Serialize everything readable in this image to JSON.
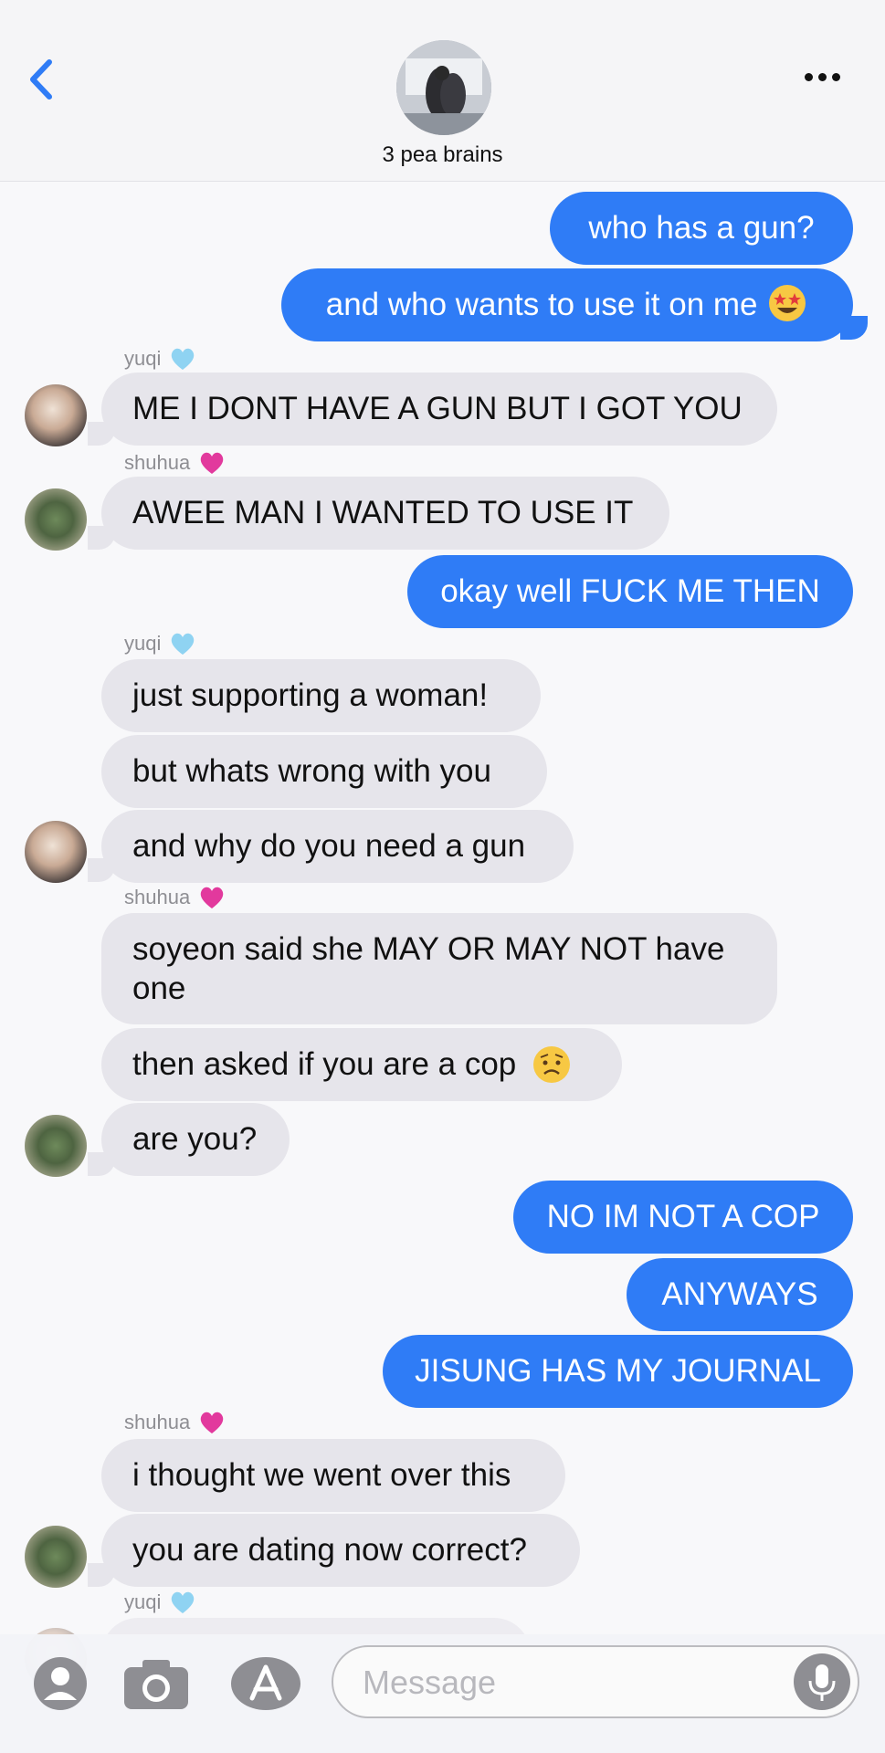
{
  "header": {
    "group_name": "3 pea brains"
  },
  "messages": [
    {
      "side": "out",
      "text": "who has a gun?"
    },
    {
      "side": "out",
      "text": "and who wants to use it on me",
      "emoji": "star-struck-emoji"
    },
    {
      "side": "sender",
      "name": "yuqi",
      "heart": "light-blue-heart"
    },
    {
      "side": "in",
      "text": "ME I DONT HAVE A GUN BUT I GOT YOU"
    },
    {
      "side": "sender",
      "name": "shuhua",
      "heart": "pink-heart"
    },
    {
      "side": "in",
      "text": "AWEE MAN I WANTED TO USE IT"
    },
    {
      "side": "out",
      "text": "okay well FUCK ME THEN"
    },
    {
      "side": "sender",
      "name": "yuqi",
      "heart": "light-blue-heart"
    },
    {
      "side": "in",
      "text": "just supporting a woman!"
    },
    {
      "side": "in",
      "text": "but whats wrong with you"
    },
    {
      "side": "in",
      "text": "and why do you need a gun"
    },
    {
      "side": "sender",
      "name": "shuhua",
      "heart": "pink-heart"
    },
    {
      "side": "in",
      "text": "soyeon said she MAY OR MAY NOT have one"
    },
    {
      "side": "in",
      "text": "then asked if you are a cop",
      "emoji": "worried-face-emoji"
    },
    {
      "side": "in",
      "text": "are you?"
    },
    {
      "side": "out",
      "text": "NO IM NOT A COP"
    },
    {
      "side": "out",
      "text": "ANYWAYS"
    },
    {
      "side": "out",
      "text": "JISUNG HAS MY JOURNAL"
    },
    {
      "side": "sender",
      "name": "shuhua",
      "heart": "pink-heart"
    },
    {
      "side": "in",
      "text": "i thought we went over this"
    },
    {
      "side": "in",
      "text": "you are dating now correct?"
    },
    {
      "side": "sender",
      "name": "yuqi",
      "heart": "light-blue-heart"
    }
  ],
  "input": {
    "placeholder": "Message"
  },
  "colors": {
    "outgoing": "#2f7cf6",
    "incoming": "#e6e5eb",
    "accent": "#2f7cf6"
  }
}
